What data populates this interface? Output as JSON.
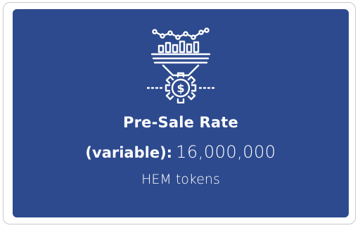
{
  "card": {
    "title": "Pre-Sale Rate",
    "value_prefix": "(variable):",
    "value": "16,000,000",
    "unit": "HEM tokens",
    "icon": "funnel-dollar-gear-icon",
    "background_color": "#2d4a8e",
    "text_color": "#ffffff"
  }
}
